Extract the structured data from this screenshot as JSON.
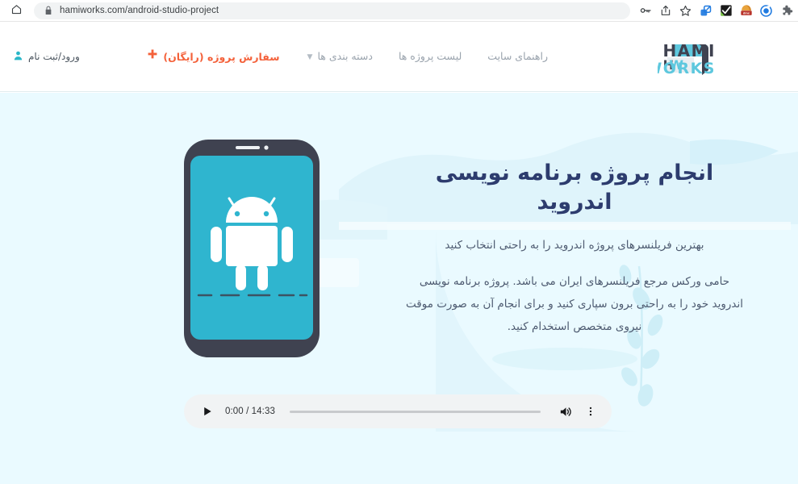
{
  "browser": {
    "home_icon": "home-icon",
    "lock_icon": "lock-secure-icon",
    "url": "hamiworks.com/android-studio-project",
    "actions": [
      {
        "name": "password-key-icon",
        "glyph": "key"
      },
      {
        "name": "share-icon",
        "glyph": "share"
      },
      {
        "name": "bookmark-star-icon",
        "glyph": "star"
      },
      {
        "name": "extension-link-icon",
        "glyph": "ext-link"
      },
      {
        "name": "extension-checkmark-icon",
        "glyph": "ext-check"
      },
      {
        "name": "extension-dmc-icon",
        "glyph": "ext-dmc",
        "label": "dmc"
      },
      {
        "name": "extension-refresh-icon",
        "glyph": "ext-refresh"
      },
      {
        "name": "extensions-puzzle-icon",
        "glyph": "puzzle"
      }
    ]
  },
  "site_header": {
    "logo": {
      "mark_text": "HW",
      "line1": "HAMI",
      "line2": "WORKS"
    },
    "nav": [
      {
        "name": "sitemap",
        "label": "راهنمای سایت",
        "has_dropdown": false
      },
      {
        "name": "projects-list",
        "label": "لیست پروژه ها",
        "has_dropdown": false
      },
      {
        "name": "categories",
        "label": "دسته بندی ها",
        "has_dropdown": true
      }
    ],
    "order_cta": {
      "label": "سفارش پروژه (رایگان)",
      "plus": "+",
      "color": "#f4613a"
    },
    "login": {
      "label": "ورود/ثبت نام",
      "icon": "user-person-icon",
      "color": "#2ab7c8"
    }
  },
  "hero": {
    "title": "انجام پروژه برنامه نویسی اندروید",
    "subtitle": "بهترین فریلنسرهای پروژه اندروید را به راحتی انتخاب کنید",
    "body": "حامی ورکس مرجع فریلنسرهای ایران می باشد. پروژه برنامه نویسی اندروید خود را به راحتی برون سپاری کنید و برای انجام آن به صورت موقت نیروی متخصص استخدام کنید.",
    "background_color": "#eafaff",
    "title_color": "#2d3c6e",
    "illustration": {
      "name": "android-phone-illustration",
      "screen_color": "#2fb5cf",
      "frame_color": "#3f4250",
      "robot_color": "#ffffff"
    }
  },
  "audio_player": {
    "play_label": "Play",
    "time_display": "0:00 / 14:33",
    "current_time": "0:00",
    "duration": "14:33",
    "progress_percent": 0,
    "volume_icon": "volume-on-icon",
    "more_icon": "more-options-kebab-icon"
  }
}
